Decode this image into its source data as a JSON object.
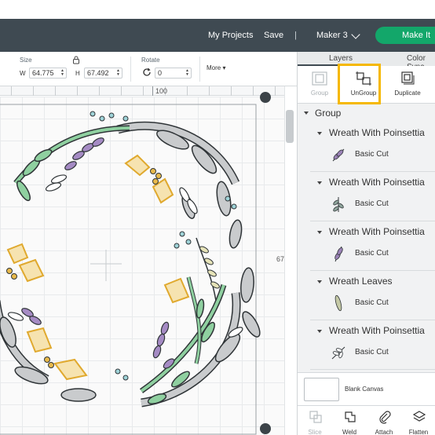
{
  "header": {
    "my_projects": "My Projects",
    "save": "Save",
    "separator": "|",
    "machine": "Maker 3",
    "make_it": "Make It",
    "background_color": "#3f4a52",
    "make_it_color": "#13a76a"
  },
  "toolbar": {
    "size_label": "Size",
    "w_letter": "W",
    "w_value": "64.775",
    "h_letter": "H",
    "h_value": "67.492",
    "rotate_label": "Rotate",
    "rotate_value": "0",
    "more_label": "More"
  },
  "ruler": {
    "top_number": "100",
    "side_number": "67"
  },
  "panel": {
    "tabs": [
      "Layers",
      "Color Sync"
    ],
    "actions": [
      {
        "label": "Group",
        "icon": "group-icon",
        "enabled": false
      },
      {
        "label": "UnGroup",
        "icon": "ungroup-icon",
        "enabled": true,
        "highlighted": true
      },
      {
        "label": "Duplicate",
        "icon": "duplicate-icon",
        "enabled": true
      }
    ],
    "group_name": "Group",
    "layers": [
      {
        "name": "Wreath With Poinsettia",
        "operation": "Basic Cut",
        "thumb_color": "#9b82b6"
      },
      {
        "name": "Wreath With Poinsettia",
        "operation": "Basic Cut",
        "thumb_color": "#8fa59c"
      },
      {
        "name": "Wreath With Poinsettia",
        "operation": "Basic Cut",
        "thumb_color": "#9b82b6"
      },
      {
        "name": "Wreath Leaves",
        "operation": "Basic Cut",
        "thumb_color": "#c5c9a6"
      },
      {
        "name": "Wreath With Poinsettia",
        "operation": "Basic Cut",
        "thumb_color": "#bfc2c4"
      }
    ],
    "blank_canvas": "Blank Canvas",
    "bottom_actions": [
      {
        "label": "Slice",
        "icon": "slice-icon",
        "enabled": false
      },
      {
        "label": "Weld",
        "icon": "weld-icon",
        "enabled": true
      },
      {
        "label": "Attach",
        "icon": "attach-icon",
        "enabled": true
      },
      {
        "label": "Flatten",
        "icon": "flatten-icon",
        "enabled": true
      }
    ]
  },
  "wreath_colors": {
    "leaf_green": "#8fd0a0",
    "leaf_gray": "#c9cbcd",
    "lavender": "#a58bc4",
    "holly_gold": "#e8b94a",
    "berry_blue": "#9fd3d8",
    "outline": "#2f3437"
  }
}
